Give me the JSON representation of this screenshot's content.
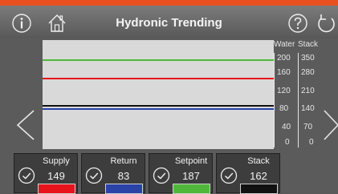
{
  "header": {
    "title": "Hydronic Trending",
    "icons": [
      "info-icon",
      "home-icon",
      "help-icon",
      "back-icon"
    ]
  },
  "axes": {
    "water_label": "Water",
    "stack_label": "Stack",
    "water_ticks": [
      "200",
      "160",
      "120",
      "80",
      "40",
      "0"
    ],
    "stack_ticks": [
      "350",
      "280",
      "210",
      "140",
      "70",
      "0"
    ]
  },
  "trend_colors": {
    "supply": "#e8141c",
    "return": "#2a43a8",
    "setpoint": "#4fb83a",
    "stack": "#111111"
  },
  "tiles": [
    {
      "label": "Supply",
      "value": "149",
      "color": "#e8141c"
    },
    {
      "label": "Return",
      "value": "83",
      "color": "#2a43a8"
    },
    {
      "label": "Setpoint",
      "value": "187",
      "color": "#4fb83a"
    },
    {
      "label": "Stack",
      "value": "162",
      "color": "#111111"
    }
  ],
  "nav": {
    "left_icon": "chevron-left-icon",
    "right_icon": "chevron-right-icon"
  }
}
